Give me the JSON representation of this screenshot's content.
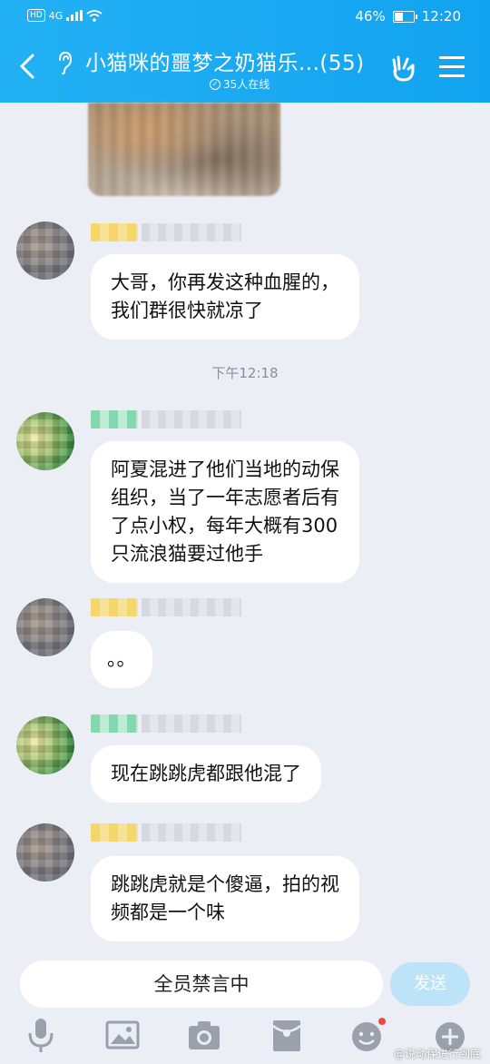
{
  "status_bar": {
    "network_label": "HD",
    "signal_label": "4G",
    "battery": "46%",
    "time": "12:20"
  },
  "header": {
    "title": "小猫咪的噩梦之奶猫乐...(55)",
    "online": "35人在线",
    "icons": [
      "back-arrow",
      "ear-icon",
      "hand-icon",
      "menu-icon"
    ]
  },
  "messages": [
    {
      "type": "text",
      "avatar": "a",
      "tag_color": "yellow",
      "text": "大哥，你再发这种血腥的，\n我们群很快就凉了"
    },
    {
      "type": "time",
      "text": "下午12:18"
    },
    {
      "type": "text",
      "avatar": "b",
      "tag_color": "green",
      "text": "阿夏混进了他们当地的动保\n组织，当了一年志愿者后有\n了点小权，每年大概有300\n只流浪猫要过他手"
    },
    {
      "type": "text",
      "avatar": "a",
      "tag_color": "yellow",
      "text": "。。"
    },
    {
      "type": "text",
      "avatar": "b",
      "tag_color": "green",
      "text": "现在跳跳虎都跟他混了"
    },
    {
      "type": "text",
      "avatar": "a",
      "tag_color": "yellow",
      "text": "跳跳虎就是个傻逼，拍的视\n频都是一个味"
    }
  ],
  "input_bar": {
    "muted_text": "全员禁言中",
    "send_label": "发送",
    "tools": [
      "mic-icon",
      "image-icon",
      "camera-icon",
      "red-packet-icon",
      "emoji-icon",
      "plus-icon"
    ]
  },
  "watermark": "@说动保进行到底",
  "colors": {
    "header": "#1aa8f2",
    "background": "#ebeef4",
    "send_disabled": "#bde3f8"
  }
}
